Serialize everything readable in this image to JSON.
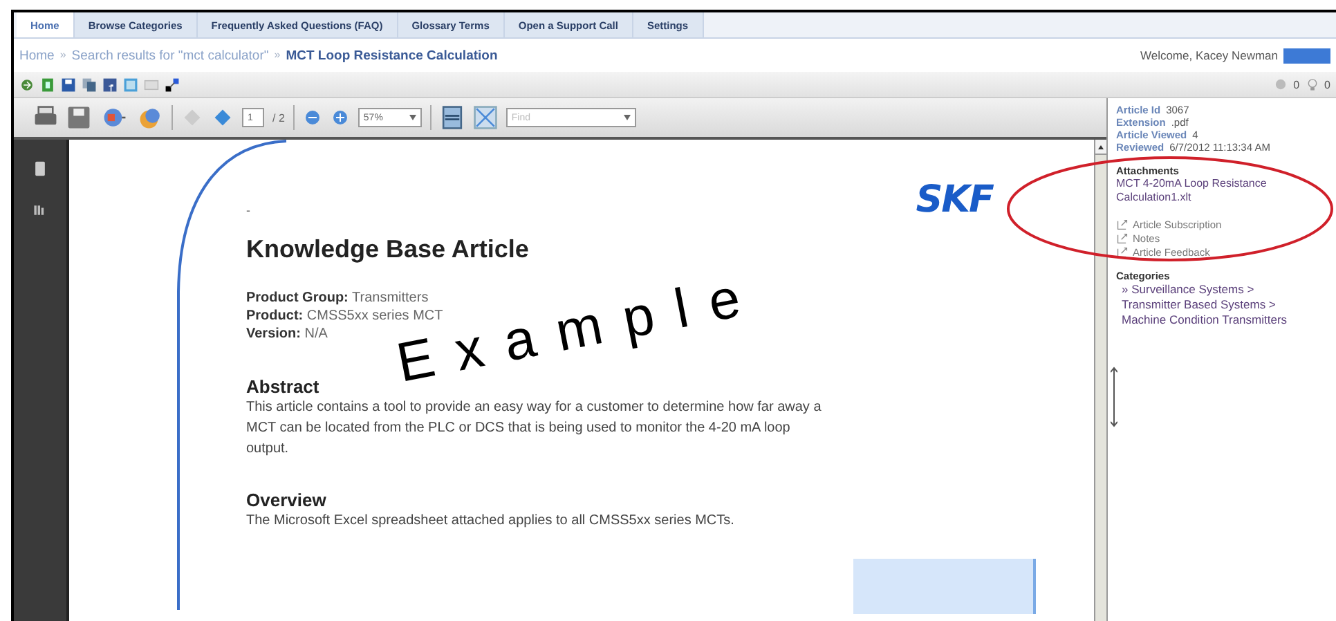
{
  "tabs": [
    {
      "label": "Home",
      "selected": true
    },
    {
      "label": "Browse Categories",
      "selected": false
    },
    {
      "label": "Frequently Asked Questions (FAQ)",
      "selected": false
    },
    {
      "label": "Glossary Terms",
      "selected": false
    },
    {
      "label": "Open a Support Call",
      "selected": false
    },
    {
      "label": "Settings",
      "selected": false
    }
  ],
  "breadcrumb": [
    {
      "text": "Home",
      "current": false
    },
    {
      "text": "»",
      "kind": "separator"
    },
    {
      "text": "Search results for \"mct calculator\"",
      "current": false
    },
    {
      "text": "»",
      "kind": "separator"
    },
    {
      "text": "MCT Loop Resistance Calculation",
      "current": true
    }
  ],
  "welcome": "Welcome, Kacey Newman",
  "counts": [
    "0",
    "0"
  ],
  "viewer": {
    "page_number": "1",
    "page_total": "/ 2",
    "zoom": "57%",
    "find_placeholder": "Find"
  },
  "document": {
    "top_mark": "-",
    "logo": "SKF",
    "title": "Knowledge Base Article",
    "fields": [
      {
        "label": "Product Group:",
        "value": "Transmitters"
      },
      {
        "label": "Product:",
        "value": "CMSS5xx series MCT"
      },
      {
        "label": "Version:",
        "value": "N/A"
      }
    ],
    "stamp": "Example",
    "sections": [
      {
        "heading": "Abstract",
        "text": "This article contains a tool to provide an easy way for a customer to determine how far away a MCT can be located from the PLC or DCS that is being used to monitor the 4-20 mA loop output."
      },
      {
        "heading": "Overview",
        "text": "The Microsoft Excel spreadsheet attached applies to all CMSS5xx series MCTs."
      }
    ]
  },
  "article_info": [
    {
      "label": "Article Id",
      "value": "3067"
    },
    {
      "label": "Extension",
      "value": ".pdf"
    },
    {
      "label": "Article Viewed",
      "value": "4"
    },
    {
      "label": "Reviewed",
      "value": "6/7/2012 11:13:34 AM"
    }
  ],
  "attachments": {
    "heading": "Attachments",
    "files": [
      "MCT 4-20mA Loop Resistance Calculation1.xlt"
    ]
  },
  "actions": [
    "Article Subscription",
    "Notes",
    "Article Feedback"
  ],
  "categories": {
    "heading": "Categories",
    "items": [
      "» Surveillance Systems > Transmitter Based Systems > Machine Condition Transmitters"
    ]
  }
}
